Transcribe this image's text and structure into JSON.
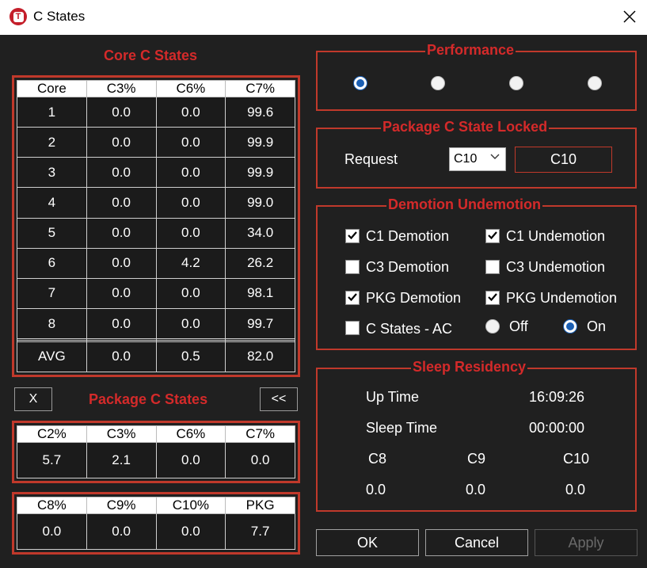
{
  "window": {
    "title": "C States",
    "app_icon_letter": "T"
  },
  "core_c_states": {
    "title": "Core C States",
    "headers": [
      "Core",
      "C3%",
      "C6%",
      "C7%"
    ],
    "rows": [
      [
        "1",
        "0.0",
        "0.0",
        "99.6"
      ],
      [
        "2",
        "0.0",
        "0.0",
        "99.9"
      ],
      [
        "3",
        "0.0",
        "0.0",
        "99.9"
      ],
      [
        "4",
        "0.0",
        "0.0",
        "99.0"
      ],
      [
        "5",
        "0.0",
        "0.0",
        "34.0"
      ],
      [
        "6",
        "0.0",
        "4.2",
        "26.2"
      ],
      [
        "7",
        "0.0",
        "0.0",
        "98.1"
      ],
      [
        "8",
        "0.0",
        "0.0",
        "99.7"
      ],
      [
        "",
        "",
        "",
        ""
      ],
      [
        "",
        "",
        "",
        ""
      ],
      [
        "AVG",
        "0.0",
        "0.5",
        "82.0"
      ]
    ]
  },
  "package_c_states": {
    "title": "Package C States",
    "close_label": "X",
    "collapse_label": "<<",
    "table1_headers": [
      "C2%",
      "C3%",
      "C6%",
      "C7%"
    ],
    "table1_values": [
      "5.7",
      "2.1",
      "0.0",
      "0.0"
    ],
    "table2_headers": [
      "C8%",
      "C9%",
      "C10%",
      "PKG"
    ],
    "table2_values": [
      "0.0",
      "0.0",
      "0.0",
      "7.7"
    ]
  },
  "performance": {
    "title": "Performance",
    "selected_index": 0,
    "option_count": 4
  },
  "package_locked": {
    "title": "Package C State Locked",
    "request_label": "Request",
    "select_value": "C10",
    "current_value": "C10"
  },
  "demotion": {
    "title": "Demotion Undemotion",
    "c1_demotion": {
      "label": "C1 Demotion",
      "checked": true
    },
    "c1_undemotion": {
      "label": "C1 Undemotion",
      "checked": true
    },
    "c3_demotion": {
      "label": "C3 Demotion",
      "checked": false
    },
    "c3_undemotion": {
      "label": "C3 Undemotion",
      "checked": false
    },
    "pkg_demotion": {
      "label": "PKG Demotion",
      "checked": true
    },
    "pkg_undemotion": {
      "label": "PKG Undemotion",
      "checked": true
    },
    "c_states_ac": {
      "label": "C States - AC",
      "checked": false
    },
    "off_label": "Off",
    "on_label": "On",
    "ac_selected": "On"
  },
  "sleep_residency": {
    "title": "Sleep Residency",
    "up_time_label": "Up Time",
    "up_time_value": "16:09:26",
    "sleep_time_label": "Sleep Time",
    "sleep_time_value": "00:00:00",
    "c8_label": "C8",
    "c9_label": "C9",
    "c10_label": "C10",
    "c8_value": "0.0",
    "c9_value": "0.0",
    "c10_value": "0.0"
  },
  "buttons": {
    "ok": "OK",
    "cancel": "Cancel",
    "apply": "Apply"
  },
  "colors": {
    "accent_red": "#c0392b",
    "title_red": "#d42a2a",
    "background": "#202020",
    "radio_blue": "#1a5fb4"
  }
}
